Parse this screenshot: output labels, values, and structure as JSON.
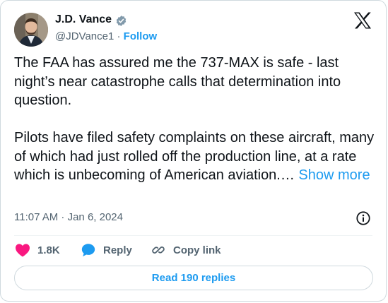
{
  "author": {
    "name": "J.D. Vance",
    "handle": "@JDVance1",
    "separator": "·",
    "follow_label": "Follow"
  },
  "tweet": {
    "text": "The FAA has assured me the 737-MAX is safe - last night’s near catastrophe calls that determination into question.\n\nPilots have filed safety complaints on these aircraft, many of which had just rolled off the production line, at a rate which is unbecoming of American aviation.… ",
    "show_more_label": "Show more",
    "timestamp": "11:07 AM · Jan 6, 2024"
  },
  "actions": {
    "like_count": "1.8K",
    "reply_label": "Reply",
    "copy_link_label": "Copy link"
  },
  "replies_button_label": "Read 190 replies",
  "icons": {
    "verified": "verified-badge-icon",
    "logo": "x-logo-icon",
    "info": "info-icon",
    "like": "heart-icon",
    "reply": "speech-bubble-icon",
    "copy_link": "link-icon"
  },
  "colors": {
    "accent": "#1d9bf0",
    "like": "#f91880",
    "text": "#0f1419",
    "secondary": "#536471",
    "border": "#cfd9de"
  }
}
